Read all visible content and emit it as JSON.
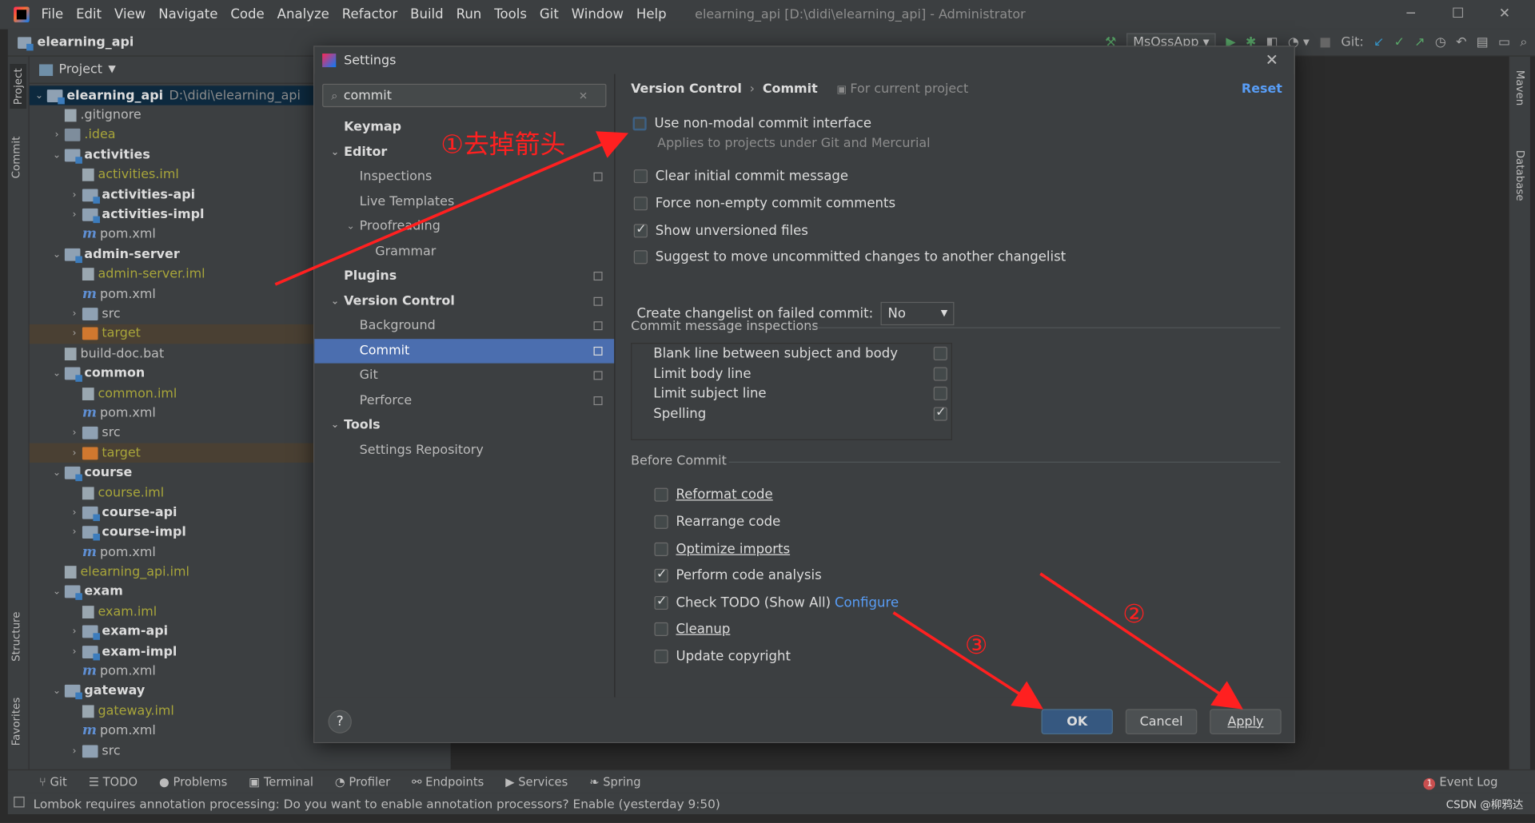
{
  "title_bar": {
    "menu": [
      "File",
      "Edit",
      "View",
      "Navigate",
      "Code",
      "Analyze",
      "Refactor",
      "Build",
      "Run",
      "Tools",
      "Git",
      "Window",
      "Help"
    ],
    "title": "elearning_api [D:\\didi\\elearning_api] - Administrator"
  },
  "nav_bar": {
    "project": "elearning_api",
    "run_config": "MsOssApp",
    "git_label": "Git:"
  },
  "left_stripe": {
    "project_tab": "Project",
    "commit_tab": "Commit",
    "structure_tab": "Structure",
    "favorites_tab": "Favorites"
  },
  "right_stripe": {
    "maven_tab": "Maven",
    "database_tab": "Database"
  },
  "project_panel": {
    "header": "Project",
    "root_name": "elearning_api",
    "root_path": "D:\\didi\\elearning_api",
    "items": [
      ".gitignore",
      ".idea",
      "activities",
      "activities.iml",
      "activities-api",
      "activities-impl",
      "pom.xml",
      "admin-server",
      "admin-server.iml",
      "pom.xml",
      "src",
      "target",
      "build-doc.bat",
      "common",
      "common.iml",
      "pom.xml",
      "src",
      "target",
      "course",
      "course.iml",
      "course-api",
      "course-impl",
      "pom.xml",
      "elearning_api.iml",
      "exam",
      "exam.iml",
      "exam-api",
      "exam-impl",
      "pom.xml",
      "gateway",
      "gateway.iml",
      "pom.xml",
      "src"
    ]
  },
  "bottom_bar": {
    "tools": [
      "Git",
      "TODO",
      "Problems",
      "Terminal",
      "Profiler",
      "Endpoints",
      "Services",
      "Spring"
    ],
    "event_log": "Event Log",
    "event_count": "1"
  },
  "status_bar": {
    "message": "Lombok requires annotation processing: Do you want to enable annotation processors? Enable (yesterday 9:50)",
    "watermark": "CSDN @柳鸦达"
  },
  "settings": {
    "title": "Settings",
    "search_value": "commit",
    "tree": {
      "keymap": "Keymap",
      "editor": "Editor",
      "inspections": "Inspections",
      "live_templates": "Live Templates",
      "proofreading": "Proofreading",
      "grammar": "Grammar",
      "plugins": "Plugins",
      "version_control": "Version Control",
      "background": "Background",
      "commit": "Commit",
      "git": "Git",
      "perforce": "Perforce",
      "tools": "Tools",
      "settings_repository": "Settings Repository"
    },
    "breadcrumb": {
      "parent": "Version Control",
      "sep": "›",
      "current": "Commit"
    },
    "for_current_project": "For current project",
    "reset": "Reset",
    "options": {
      "non_modal": "Use non-modal commit interface",
      "non_modal_note": "Applies to projects under Git and Mercurial",
      "clear_initial": "Clear initial commit message",
      "force_non_empty": "Force non-empty commit comments",
      "show_unversioned": "Show unversioned files",
      "suggest_move": "Suggest to move uncommitted changes to another changelist",
      "create_changelist": "Create changelist on failed commit:",
      "create_changelist_value": "No"
    },
    "inspections_section": "Commit message inspections",
    "inspections": {
      "blank_line": "Blank line between subject and body",
      "limit_body": "Limit body line",
      "limit_subject": "Limit subject line",
      "spelling": "Spelling"
    },
    "before_commit_section": "Before Commit",
    "before_commit": {
      "reformat": "Reformat code",
      "rearrange": "Rearrange code",
      "optimize": "Optimize imports",
      "analysis": "Perform code analysis",
      "todo": "Check TODO (Show All)",
      "configure": "Configure",
      "cleanup": "Cleanup",
      "copyright": "Update copyright"
    },
    "buttons": {
      "help": "?",
      "ok": "OK",
      "cancel": "Cancel",
      "apply": "Apply"
    }
  },
  "annotations": {
    "step1": "①去掉箭头",
    "step2": "②",
    "step3": "③",
    "color": "#ff2020"
  }
}
